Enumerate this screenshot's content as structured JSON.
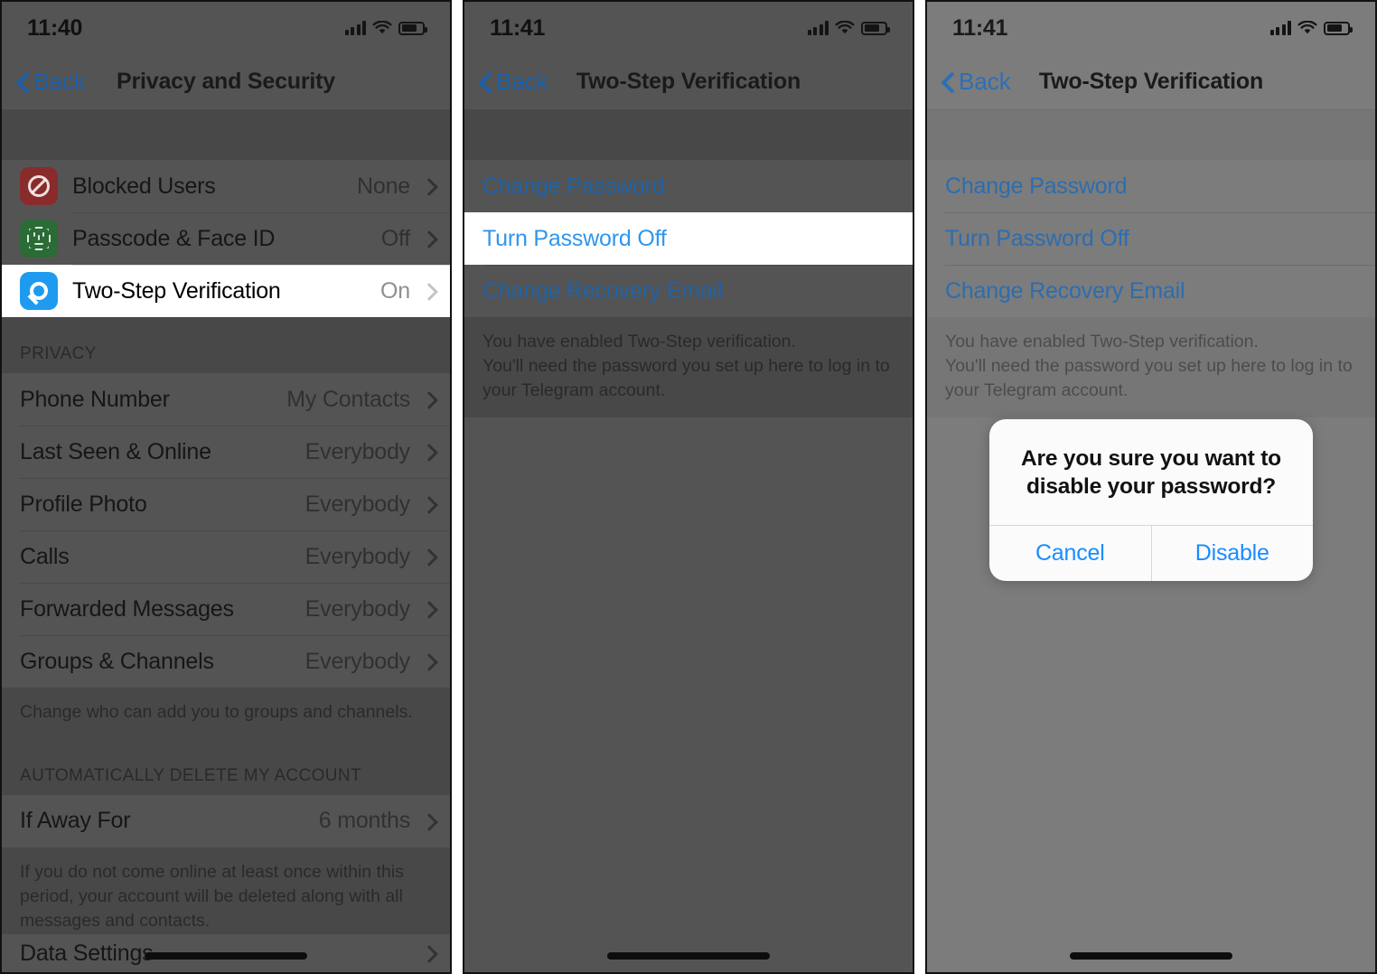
{
  "panels": [
    {
      "id": "privacy-and-security",
      "status": {
        "time": "11:40",
        "signal_icon": "cellular-bars-icon",
        "wifi_icon": "wifi-icon",
        "battery_icon": "battery-icon"
      },
      "nav": {
        "back_label": "Back",
        "title": "Privacy and Security"
      },
      "security_rows": [
        {
          "icon": "blocked-users-icon",
          "label": "Blocked Users",
          "value": "None",
          "highlighted": false
        },
        {
          "icon": "face-id-icon",
          "label": "Passcode & Face ID",
          "value": "Off",
          "highlighted": false
        },
        {
          "icon": "key-icon",
          "label": "Two-Step Verification",
          "value": "On",
          "highlighted": true
        }
      ],
      "privacy_header": "PRIVACY",
      "privacy_rows": [
        {
          "label": "Phone Number",
          "value": "My Contacts"
        },
        {
          "label": "Last Seen & Online",
          "value": "Everybody"
        },
        {
          "label": "Profile Photo",
          "value": "Everybody"
        },
        {
          "label": "Calls",
          "value": "Everybody"
        },
        {
          "label": "Forwarded Messages",
          "value": "Everybody"
        },
        {
          "label": "Groups & Channels",
          "value": "Everybody"
        }
      ],
      "privacy_footer": "Change who can add you to groups and channels.",
      "delete_header": "AUTOMATICALLY DELETE MY ACCOUNT",
      "delete_rows": [
        {
          "label": "If Away For",
          "value": "6 months"
        }
      ],
      "delete_footer": "If you do not come online at least once within this period, your account will be deleted along with all messages and contacts.",
      "bottom_row": {
        "label": "Data Settings"
      }
    },
    {
      "id": "two-step-verification-highlight",
      "status": {
        "time": "11:41",
        "signal_icon": "cellular-bars-icon",
        "wifi_icon": "wifi-icon",
        "battery_icon": "battery-icon"
      },
      "nav": {
        "back_label": "Back",
        "title": "Two-Step Verification"
      },
      "links": [
        {
          "label": "Change Password",
          "highlighted": false
        },
        {
          "label": "Turn Password Off",
          "highlighted": true
        },
        {
          "label": "Change Recovery Email",
          "highlighted": false
        }
      ],
      "footer": "You have enabled Two-Step verification.\nYou'll need the password you set up here to log in to your Telegram account."
    },
    {
      "id": "two-step-verification-alert",
      "status": {
        "time": "11:41",
        "signal_icon": "cellular-bars-icon",
        "wifi_icon": "wifi-icon",
        "battery_icon": "battery-icon"
      },
      "nav": {
        "back_label": "Back",
        "title": "Two-Step Verification"
      },
      "links": [
        {
          "label": "Change Password",
          "highlighted": false
        },
        {
          "label": "Turn Password Off",
          "highlighted": false
        },
        {
          "label": "Change Recovery Email",
          "highlighted": false
        }
      ],
      "footer": "You have enabled Two-Step verification.\nYou'll need the password you set up here to log in to your Telegram account.",
      "alert": {
        "title": "Are you sure you want to disable your password?",
        "cancel_label": "Cancel",
        "confirm_label": "Disable"
      }
    }
  ],
  "colors": {
    "accent_blue": "#2f96ed",
    "link_blue": "#1f63a8",
    "alert_blue": "#1a8cff",
    "icon_red": "#c0392b",
    "icon_green": "#27a744",
    "icon_blue": "#1e9bf0"
  }
}
